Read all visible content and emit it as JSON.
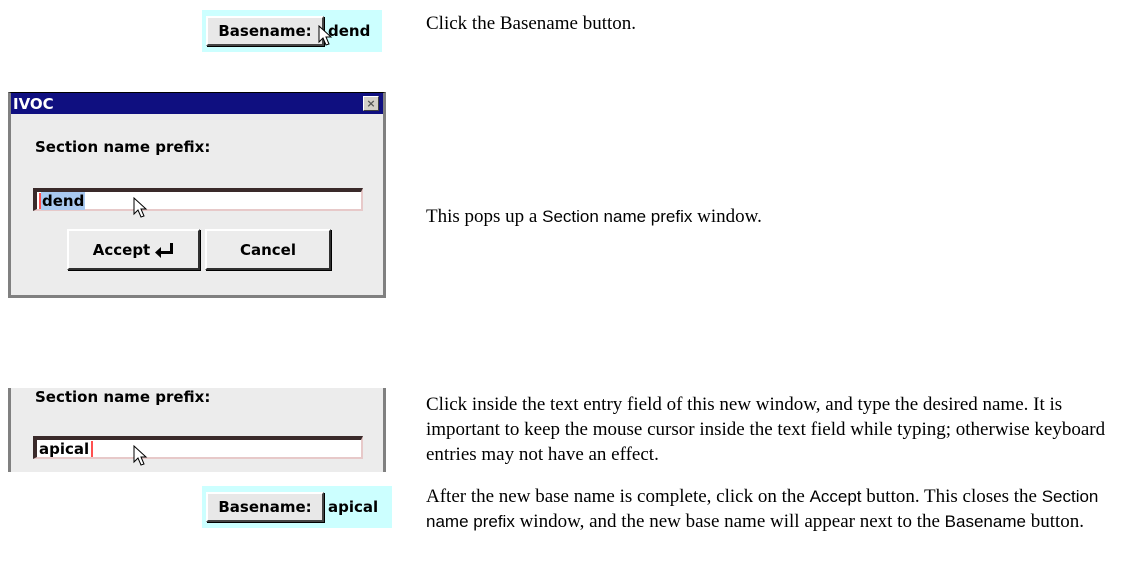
{
  "steps": {
    "step1": {
      "basename_label": "Basename:",
      "basename_value": "dend",
      "instruction": "Click the Basename button."
    },
    "step2": {
      "dialog_title": "IVOC",
      "close_glyph": "×",
      "prompt": "Section name prefix:",
      "field_value": "dend",
      "accept_label": "Accept",
      "cancel_label": "Cancel",
      "instruction_pre": "This pops up a ",
      "instruction_ref": "Section name prefix",
      "instruction_post": " window."
    },
    "step3": {
      "prompt": "Section name prefix:",
      "field_value": "apical",
      "instruction": "Click inside the text entry field of this new window, and type the desired name. It is important to keep the mouse cursor inside the text field while typing; otherwise keyboard entries may not have an effect."
    },
    "step4": {
      "basename_label": "Basename:",
      "basename_value": "apical",
      "instruction_a": "After the new base name is complete, click on the ",
      "ref_accept": "Accept",
      "instruction_b": " button. This closes the ",
      "ref_prefix": "Section name prefix",
      "instruction_c": " window, and the new base name will appear next to the ",
      "ref_basename": "Basename",
      "instruction_d": " button."
    }
  },
  "colors": {
    "panel_bg": "#ccffff",
    "title_bar": "#0f0f80",
    "selection": "#a9c9f0",
    "caret": "#ff5050"
  },
  "icons": [
    "mouse-pointer-icon",
    "close-icon",
    "enter-arrow-icon"
  ]
}
